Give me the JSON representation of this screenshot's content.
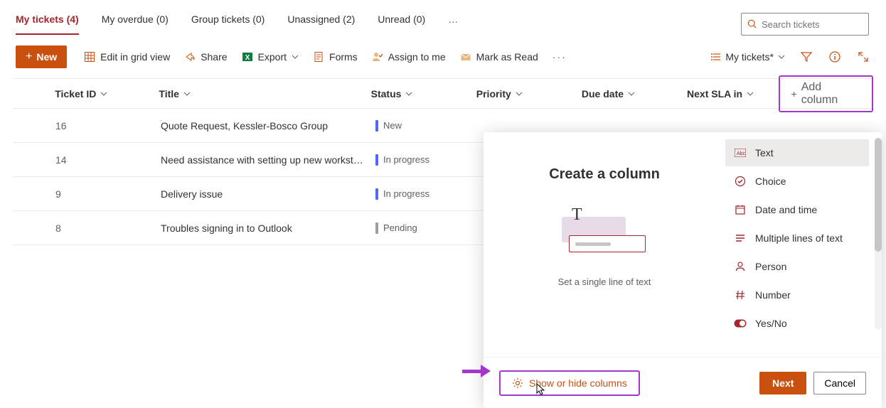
{
  "tabs": {
    "items": [
      {
        "label": "My tickets (4)",
        "active": true
      },
      {
        "label": "My overdue (0)"
      },
      {
        "label": "Group tickets (0)"
      },
      {
        "label": "Unassigned (2)"
      },
      {
        "label": "Unread (0)"
      }
    ],
    "ellipsis": "…"
  },
  "search": {
    "placeholder": "Search tickets"
  },
  "toolbar": {
    "new_label": "New",
    "edit_grid": "Edit in grid view",
    "share": "Share",
    "export": "Export",
    "forms": "Forms",
    "assign": "Assign to me",
    "mark_read": "Mark as Read",
    "view_name": "My tickets*"
  },
  "columns": {
    "ticket_id": "Ticket ID",
    "title": "Title",
    "status": "Status",
    "priority": "Priority",
    "due_date": "Due date",
    "next_sla": "Next SLA in",
    "add_column": "Add column"
  },
  "rows": [
    {
      "id": "16",
      "title": "Quote Request, Kessler-Bosco Group",
      "status": "New",
      "status_class": "status-new",
      "sparkle": true
    },
    {
      "id": "14",
      "title": "Need assistance with setting up new workst…",
      "status": "In progress",
      "status_class": "status-progress"
    },
    {
      "id": "9",
      "title": "Delivery issue",
      "status": "In progress",
      "status_class": "status-progress"
    },
    {
      "id": "8",
      "title": "Troubles signing in to Outlook",
      "status": "Pending",
      "status_class": "status-pending"
    }
  ],
  "panel": {
    "title": "Create a column",
    "desc": "Set a single line of text",
    "types": [
      {
        "label": "Text",
        "icon": "text",
        "selected": true
      },
      {
        "label": "Choice",
        "icon": "choice"
      },
      {
        "label": "Date and time",
        "icon": "date"
      },
      {
        "label": "Multiple lines of text",
        "icon": "multi"
      },
      {
        "label": "Person",
        "icon": "person"
      },
      {
        "label": "Number",
        "icon": "number"
      },
      {
        "label": "Yes/No",
        "icon": "yesno"
      }
    ],
    "show_hide": "Show or hide columns",
    "next": "Next",
    "cancel": "Cancel"
  }
}
